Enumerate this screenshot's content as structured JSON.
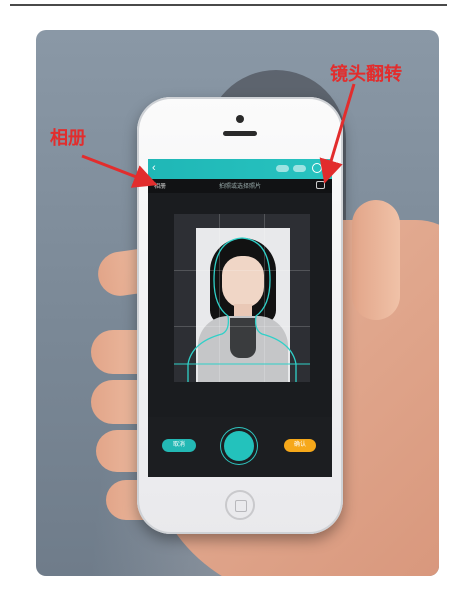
{
  "annotations": {
    "album": "相册",
    "lens_flip": "镜头翻转"
  },
  "app": {
    "header_title": "拍照或选择照片",
    "album_label": "相册",
    "cancel_label": "取消",
    "confirm_label": "确认"
  },
  "icons": {
    "back": "chevron-left-icon",
    "flip": "camera-flip-icon",
    "shutter": "shutter-icon"
  },
  "colors": {
    "annotation_red": "#e22d2d",
    "app_teal": "#23b8b4",
    "confirm_orange": "#f6a81a"
  }
}
